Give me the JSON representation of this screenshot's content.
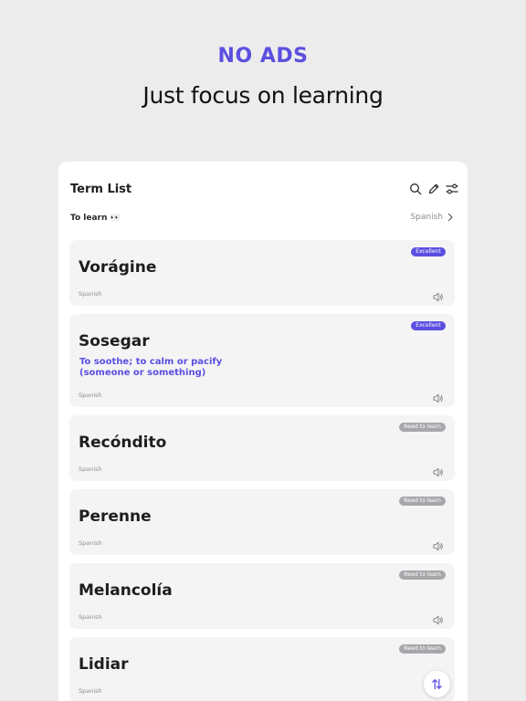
{
  "hero": {
    "headline": "NO ADS",
    "subheadline": "Just focus on learning"
  },
  "header": {
    "title": "Term List",
    "icons": [
      "search-icon",
      "edit-icon",
      "filter-sliders-icon"
    ]
  },
  "filter": {
    "label": "To learn 👀",
    "language": "Spanish"
  },
  "colors": {
    "accent": "#5b4fe0",
    "badge_neutral": "#a7a7ab",
    "card_bg": "#f4f4f5"
  },
  "terms": [
    {
      "term": "Vorágine",
      "badge": "Excellent",
      "definition": "",
      "language": "Spanish"
    },
    {
      "term": "Sosegar",
      "badge": "Excellent",
      "definition": "To soothe; to calm or pacify (someone or something)",
      "language": "Spanish"
    },
    {
      "term": "Recóndito",
      "badge": "Need to learn",
      "definition": "",
      "language": "Spanish"
    },
    {
      "term": "Perenne",
      "badge": "Need to learn",
      "definition": "",
      "language": "Spanish"
    },
    {
      "term": "Melancolía",
      "badge": "Need to learn",
      "definition": "",
      "language": "Spanish"
    },
    {
      "term": "Lidiar",
      "badge": "Need to learn",
      "definition": "",
      "language": "Spanish"
    }
  ],
  "fab": {
    "icon": "sort-arrows-icon"
  }
}
